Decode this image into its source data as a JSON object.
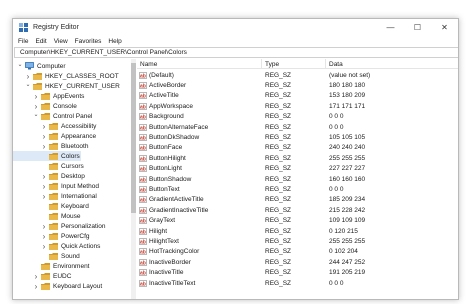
{
  "window": {
    "title": "Registry Editor",
    "controls": {
      "minimize": "—",
      "maximize": "☐",
      "close": "✕"
    }
  },
  "menu": [
    "File",
    "Edit",
    "View",
    "Favorites",
    "Help"
  ],
  "address": "Computer\\HKEY_CURRENT_USER\\Control Panel\\Colors",
  "tree": [
    {
      "label": "Computer",
      "level": 0,
      "caret": "open",
      "icon": "computer-icon"
    },
    {
      "label": "HKEY_CLASSES_ROOT",
      "level": 1,
      "caret": "closed",
      "icon": "folder-icon"
    },
    {
      "label": "HKEY_CURRENT_USER",
      "level": 1,
      "caret": "open",
      "icon": "folder-icon"
    },
    {
      "label": "AppEvents",
      "level": 2,
      "caret": "closed",
      "icon": "folder-icon"
    },
    {
      "label": "Console",
      "level": 2,
      "caret": "closed",
      "icon": "folder-icon"
    },
    {
      "label": "Control Panel",
      "level": 2,
      "caret": "open",
      "icon": "folder-icon"
    },
    {
      "label": "Accessibility",
      "level": 3,
      "caret": "closed",
      "icon": "folder-icon"
    },
    {
      "label": "Appearance",
      "level": 3,
      "caret": "closed",
      "icon": "folder-icon"
    },
    {
      "label": "Bluetooth",
      "level": 3,
      "caret": "closed",
      "icon": "folder-icon"
    },
    {
      "label": "Colors",
      "level": 3,
      "caret": "none",
      "icon": "folder-icon",
      "selected": true
    },
    {
      "label": "Cursors",
      "level": 3,
      "caret": "none",
      "icon": "folder-icon"
    },
    {
      "label": "Desktop",
      "level": 3,
      "caret": "closed",
      "icon": "folder-icon"
    },
    {
      "label": "Input Method",
      "level": 3,
      "caret": "closed",
      "icon": "folder-icon"
    },
    {
      "label": "International",
      "level": 3,
      "caret": "closed",
      "icon": "folder-icon"
    },
    {
      "label": "Keyboard",
      "level": 3,
      "caret": "none",
      "icon": "folder-icon"
    },
    {
      "label": "Mouse",
      "level": 3,
      "caret": "none",
      "icon": "folder-icon"
    },
    {
      "label": "Personalization",
      "level": 3,
      "caret": "closed",
      "icon": "folder-icon"
    },
    {
      "label": "PowerCfg",
      "level": 3,
      "caret": "closed",
      "icon": "folder-icon"
    },
    {
      "label": "Quick Actions",
      "level": 3,
      "caret": "closed",
      "icon": "folder-icon"
    },
    {
      "label": "Sound",
      "level": 3,
      "caret": "none",
      "icon": "folder-icon"
    },
    {
      "label": "Environment",
      "level": 2,
      "caret": "none",
      "icon": "folder-icon"
    },
    {
      "label": "EUDC",
      "level": 2,
      "caret": "closed",
      "icon": "folder-icon"
    },
    {
      "label": "Keyboard Layout",
      "level": 2,
      "caret": "closed",
      "icon": "folder-icon"
    }
  ],
  "list": {
    "headers": {
      "name": "Name",
      "type": "Type",
      "data": "Data"
    },
    "rows": [
      {
        "name": "(Default)",
        "type": "REG_SZ",
        "data": "(value not set)"
      },
      {
        "name": "ActiveBorder",
        "type": "REG_SZ",
        "data": "180 180 180"
      },
      {
        "name": "ActiveTitle",
        "type": "REG_SZ",
        "data": "153 180 209"
      },
      {
        "name": "AppWorkspace",
        "type": "REG_SZ",
        "data": "171 171 171"
      },
      {
        "name": "Background",
        "type": "REG_SZ",
        "data": "0 0 0"
      },
      {
        "name": "ButtonAlternateFace",
        "type": "REG_SZ",
        "data": "0 0 0"
      },
      {
        "name": "ButtonDkShadow",
        "type": "REG_SZ",
        "data": "105 105 105"
      },
      {
        "name": "ButtonFace",
        "type": "REG_SZ",
        "data": "240 240 240"
      },
      {
        "name": "ButtonHilight",
        "type": "REG_SZ",
        "data": "255 255 255"
      },
      {
        "name": "ButtonLight",
        "type": "REG_SZ",
        "data": "227 227 227"
      },
      {
        "name": "ButtonShadow",
        "type": "REG_SZ",
        "data": "160 160 160"
      },
      {
        "name": "ButtonText",
        "type": "REG_SZ",
        "data": "0 0 0"
      },
      {
        "name": "GradientActiveTitle",
        "type": "REG_SZ",
        "data": "185 209 234"
      },
      {
        "name": "GradientInactiveTitle",
        "type": "REG_SZ",
        "data": "215 228 242"
      },
      {
        "name": "GrayText",
        "type": "REG_SZ",
        "data": "109 109 109"
      },
      {
        "name": "Hilight",
        "type": "REG_SZ",
        "data": "0 120 215"
      },
      {
        "name": "HilightText",
        "type": "REG_SZ",
        "data": "255 255 255"
      },
      {
        "name": "HotTrackingColor",
        "type": "REG_SZ",
        "data": "0 102 204"
      },
      {
        "name": "InactiveBorder",
        "type": "REG_SZ",
        "data": "244 247 252"
      },
      {
        "name": "InactiveTitle",
        "type": "REG_SZ",
        "data": "191 205 219"
      },
      {
        "name": "InactiveTitleText",
        "type": "REG_SZ",
        "data": "0 0 0"
      }
    ]
  },
  "colors": {
    "folder": "#e8b84a",
    "folder_dark": "#d19a2a",
    "selection": "#dde9f7",
    "reg_icon_red": "#c0392b",
    "reg_icon_blue": "#2f6db3"
  }
}
